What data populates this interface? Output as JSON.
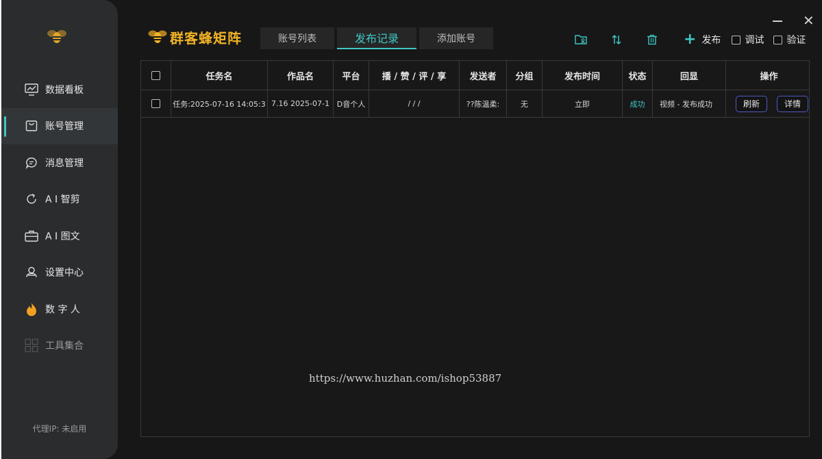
{
  "brand": {
    "name": "群客蜂矩阵"
  },
  "tabs": [
    {
      "label": "账号列表"
    },
    {
      "label": "发布记录"
    },
    {
      "label": "添加账号"
    }
  ],
  "toolbar": {
    "icons": [
      "folder-user-icon",
      "sort-icon",
      "trash-icon"
    ],
    "publish_label": "发布",
    "debug_label": "调试",
    "verify_label": "验证"
  },
  "sidebar": {
    "items": [
      {
        "label": "数据看板",
        "icon": "chart-board-icon"
      },
      {
        "label": "账号管理",
        "icon": "bag-icon"
      },
      {
        "label": "消息管理",
        "icon": "chat-icon"
      },
      {
        "label": "A I 智剪",
        "icon": "refresh-icon"
      },
      {
        "label": "A I 图文",
        "icon": "briefcase-icon"
      },
      {
        "label": "设置中心",
        "icon": "settings-icon"
      },
      {
        "label": "数 字 人",
        "icon": "flame-icon"
      },
      {
        "label": "工具集合",
        "icon": "grid-icon"
      }
    ],
    "proxy": "代理IP: 未启用"
  },
  "table": {
    "headers": [
      "任务名",
      "作品名",
      "平台",
      "播 / 赞 / 评 / 享",
      "发送者",
      "分组",
      "发布时间",
      "状态",
      "回显",
      "操作"
    ],
    "rows": [
      {
        "task": "任务:2025-07-16 14:05:3",
        "work": "7.16  2025-07-1",
        "platform": "D音个人",
        "stats": "/   /   /",
        "sender": "??陈温柔:",
        "group": "无",
        "time": "立即",
        "status": "成功",
        "echo": "视频 - 发布成功",
        "refresh": "刷新",
        "detail": "详情"
      }
    ]
  },
  "watermark": "https://www.huzhan.com/ishop53887",
  "colors": {
    "accent": "#3fc7c4",
    "brand": "#f2b326",
    "button_border": "#4b5cc4"
  }
}
